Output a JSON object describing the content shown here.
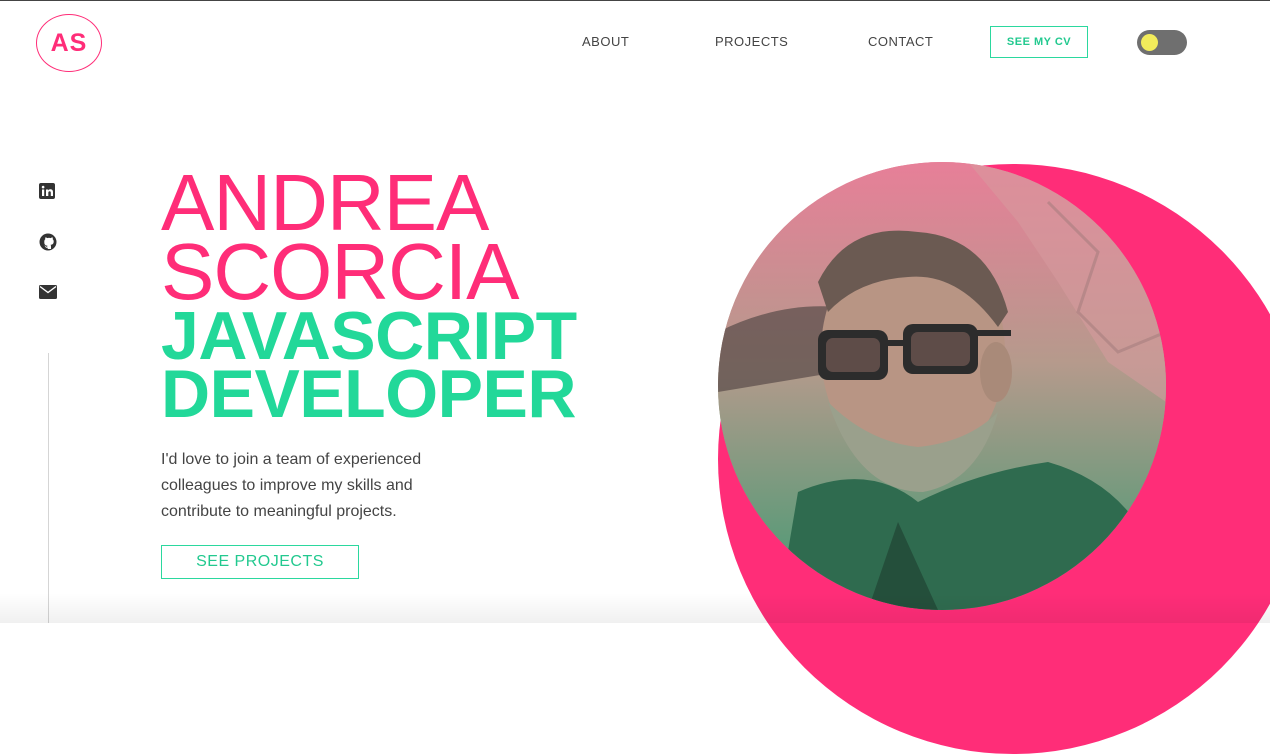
{
  "header": {
    "logo_text": "AS",
    "nav": [
      "ABOUT",
      "PROJECTS",
      "CONTACT"
    ],
    "cv_button": "SEE MY CV",
    "theme_toggle": {
      "state": "light"
    }
  },
  "social": [
    {
      "icon": "linkedin-icon"
    },
    {
      "icon": "github-icon"
    },
    {
      "icon": "mail-icon"
    }
  ],
  "hero": {
    "name_first": "ANDREA",
    "name_last": "SCORCIA",
    "role_1": "JAVASCRIPT",
    "role_2": "DEVELOPER",
    "intro": "I'd love to join a team of experienced colleagues to improve my skills and contribute to meaningful projects.",
    "projects_button": "SEE PROJECTS"
  },
  "colors": {
    "accent_pink": "#ff2d78",
    "accent_green": "#22d899",
    "toggle_knob": "#f2ec5b",
    "toggle_track": "#6f6f6f"
  }
}
